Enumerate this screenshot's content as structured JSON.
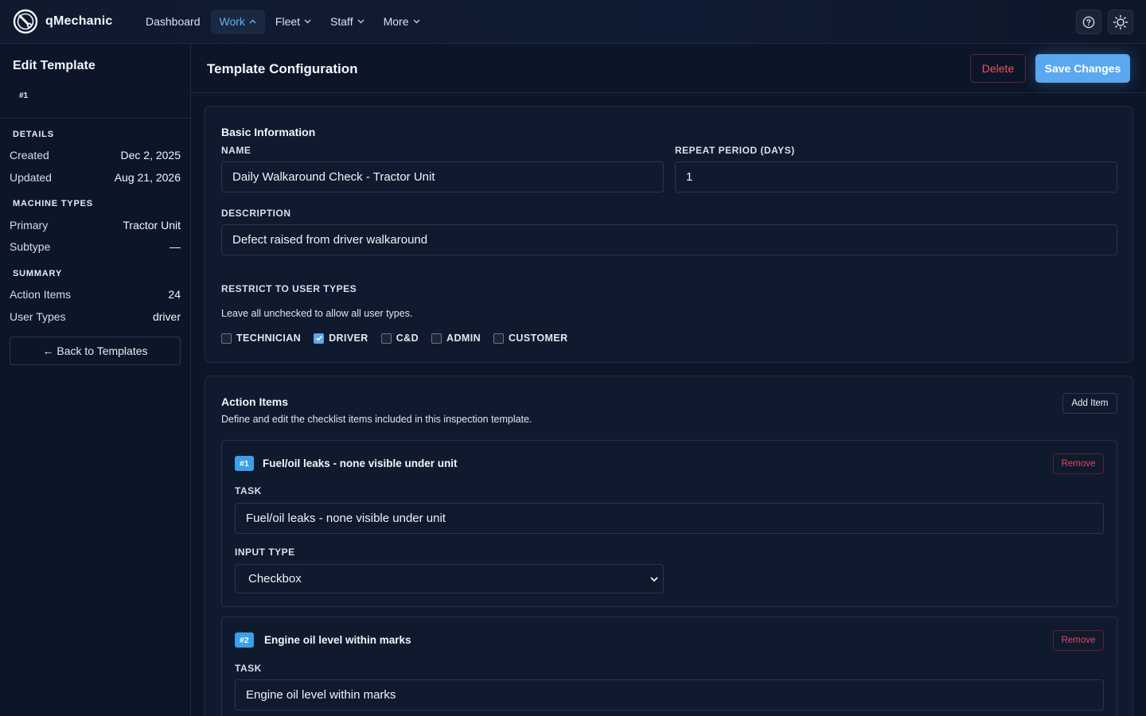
{
  "app": {
    "name": "qMechanic",
    "logo_icon": "wrench-circle-icon"
  },
  "nav": {
    "items": [
      {
        "label": "Dashboard",
        "dropdown": false
      },
      {
        "label": "Work",
        "dropdown": true,
        "active": true
      },
      {
        "label": "Fleet",
        "dropdown": true
      },
      {
        "label": "Staff",
        "dropdown": true
      },
      {
        "label": "More",
        "dropdown": true
      }
    ],
    "icons": [
      "help-icon",
      "sun-icon"
    ]
  },
  "sidebar": {
    "title": "Edit Template",
    "id": "#1",
    "details": {
      "heading": "DETAILS",
      "created_label": "Created",
      "created_value": "Dec 2, 2025",
      "updated_label": "Updated",
      "updated_value": "Aug 21, 2026"
    },
    "machine_types": {
      "heading": "MACHINE TYPES",
      "primary_label": "Primary",
      "primary_value": "Tractor Unit",
      "subtype_label": "Subtype",
      "subtype_value": "—"
    },
    "summary": {
      "heading": "SUMMARY",
      "action_items_label": "Action Items",
      "action_items_value": "24",
      "user_types_label": "User Types",
      "user_types_value": "driver"
    },
    "back_label": "← Back to Templates"
  },
  "header": {
    "title": "Template Configuration",
    "delete_label": "Delete",
    "save_label": "Save Changes"
  },
  "basic": {
    "title": "Basic Information",
    "name_label": "NAME",
    "name_value": "Daily Walkaround Check - Tractor Unit",
    "repeat_label": "REPEAT PERIOD (DAYS)",
    "repeat_value": "1",
    "description_label": "DESCRIPTION",
    "description_value": "Defect raised from driver walkaround",
    "restrict_label": "RESTRICT TO USER TYPES",
    "restrict_hint": "Leave all unchecked to allow all user types.",
    "user_types": [
      {
        "label": "TECHNICIAN",
        "checked": false
      },
      {
        "label": "DRIVER",
        "checked": true
      },
      {
        "label": "C&D",
        "checked": false
      },
      {
        "label": "ADMIN",
        "checked": false
      },
      {
        "label": "CUSTOMER",
        "checked": false
      }
    ]
  },
  "actions": {
    "title": "Action Items",
    "subtitle": "Define and edit the checklist items included in this inspection template.",
    "add_label": "Add Item",
    "remove_label": "Remove",
    "task_label": "TASK",
    "input_type_label": "INPUT TYPE",
    "items": [
      {
        "badge": "#1",
        "title": "Fuel/oil leaks - none visible under unit",
        "task": "Fuel/oil leaks - none visible under unit",
        "input_type": "Checkbox"
      },
      {
        "badge": "#2",
        "title": "Engine oil level within marks",
        "task": "Engine oil level within marks"
      }
    ]
  },
  "colors": {
    "background": "#0d1629",
    "accent": "#5aa8ef",
    "danger": "#f0505f",
    "badge": "#3aa0e8"
  }
}
